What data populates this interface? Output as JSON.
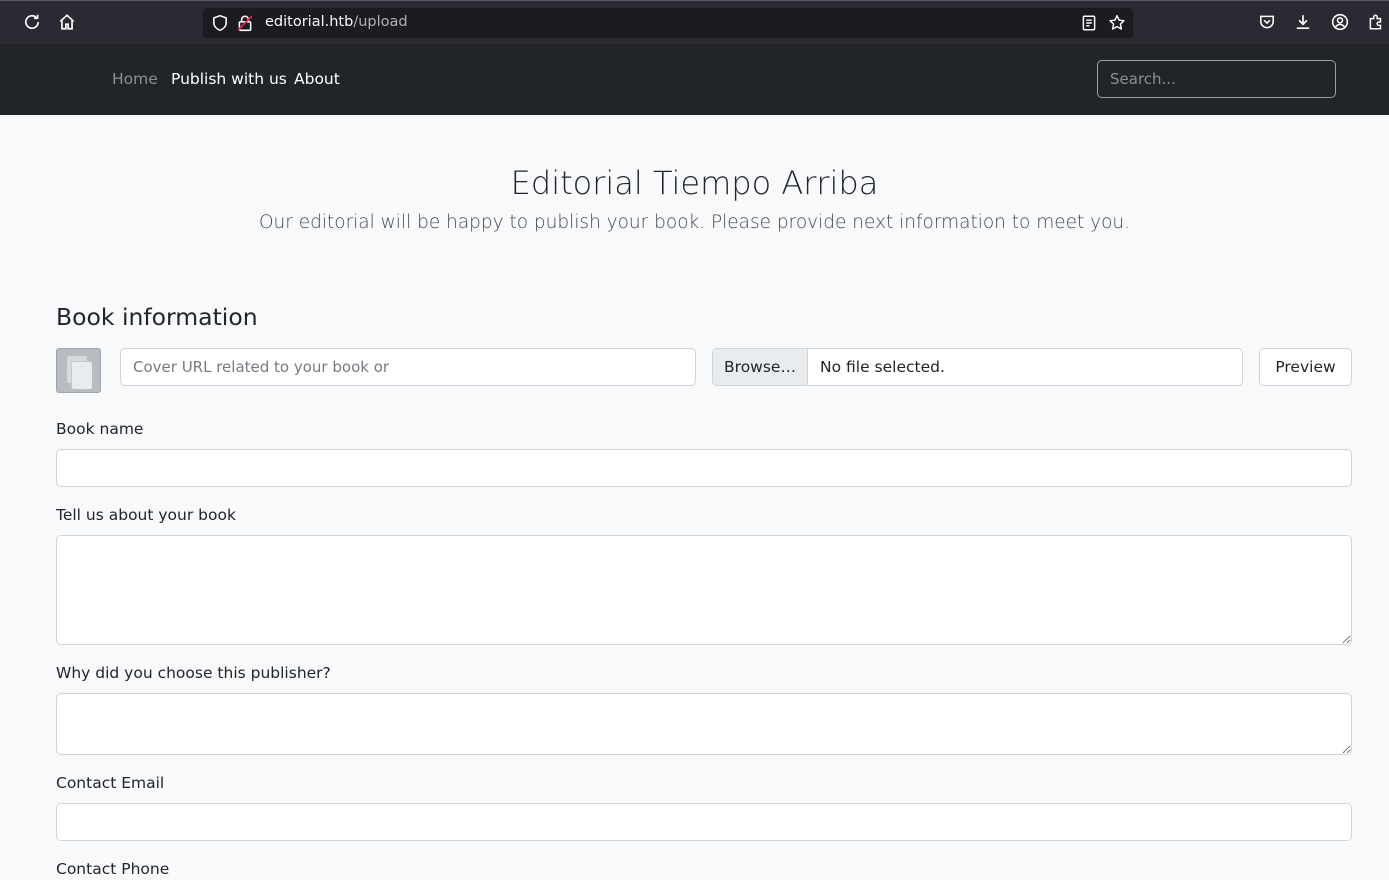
{
  "browser": {
    "url_host": "editorial.htb",
    "url_path": "/upload"
  },
  "nav": {
    "items": [
      {
        "label": "Home"
      },
      {
        "label": "Publish with us"
      },
      {
        "label": "About"
      }
    ],
    "search_placeholder": "Search..."
  },
  "hero": {
    "title": "Editorial Tiempo Arriba",
    "subtitle": "Our editorial will be happy to publish your book. Please provide next information to meet you."
  },
  "book_info": {
    "section_title": "Book information",
    "cover_url_placeholder": "Cover URL related to your book or",
    "browse_label": "Browse…",
    "file_status": "No file selected.",
    "preview_label": "Preview"
  },
  "form": {
    "book_name_label": "Book name",
    "about_label": "Tell us about your book",
    "why_label": "Why did you choose this publisher?",
    "email_label": "Contact Email",
    "phone_label": "Contact Phone"
  },
  "icons": [
    "reload-icon",
    "home-icon",
    "shield-icon",
    "lock-icon",
    "reader-view-icon",
    "bookmark-star-icon",
    "pocket-icon",
    "download-icon",
    "account-icon",
    "extensions-icon",
    "cover-placeholder-icon"
  ]
}
